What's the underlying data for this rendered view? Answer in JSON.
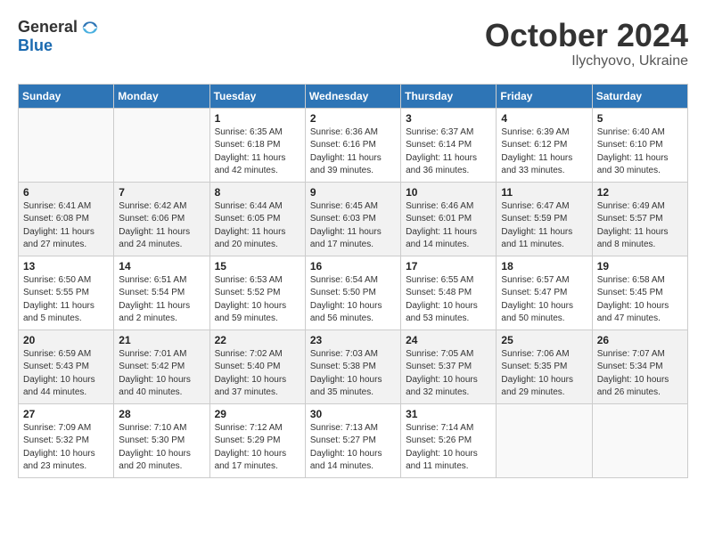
{
  "header": {
    "logo_general": "General",
    "logo_blue": "Blue",
    "month": "October 2024",
    "location": "Ilychyovo, Ukraine"
  },
  "weekdays": [
    "Sunday",
    "Monday",
    "Tuesday",
    "Wednesday",
    "Thursday",
    "Friday",
    "Saturday"
  ],
  "weeks": [
    [
      {
        "day": "",
        "info": ""
      },
      {
        "day": "",
        "info": ""
      },
      {
        "day": "1",
        "info": "Sunrise: 6:35 AM\nSunset: 6:18 PM\nDaylight: 11 hours\nand 42 minutes."
      },
      {
        "day": "2",
        "info": "Sunrise: 6:36 AM\nSunset: 6:16 PM\nDaylight: 11 hours\nand 39 minutes."
      },
      {
        "day": "3",
        "info": "Sunrise: 6:37 AM\nSunset: 6:14 PM\nDaylight: 11 hours\nand 36 minutes."
      },
      {
        "day": "4",
        "info": "Sunrise: 6:39 AM\nSunset: 6:12 PM\nDaylight: 11 hours\nand 33 minutes."
      },
      {
        "day": "5",
        "info": "Sunrise: 6:40 AM\nSunset: 6:10 PM\nDaylight: 11 hours\nand 30 minutes."
      }
    ],
    [
      {
        "day": "6",
        "info": "Sunrise: 6:41 AM\nSunset: 6:08 PM\nDaylight: 11 hours\nand 27 minutes."
      },
      {
        "day": "7",
        "info": "Sunrise: 6:42 AM\nSunset: 6:06 PM\nDaylight: 11 hours\nand 24 minutes."
      },
      {
        "day": "8",
        "info": "Sunrise: 6:44 AM\nSunset: 6:05 PM\nDaylight: 11 hours\nand 20 minutes."
      },
      {
        "day": "9",
        "info": "Sunrise: 6:45 AM\nSunset: 6:03 PM\nDaylight: 11 hours\nand 17 minutes."
      },
      {
        "day": "10",
        "info": "Sunrise: 6:46 AM\nSunset: 6:01 PM\nDaylight: 11 hours\nand 14 minutes."
      },
      {
        "day": "11",
        "info": "Sunrise: 6:47 AM\nSunset: 5:59 PM\nDaylight: 11 hours\nand 11 minutes."
      },
      {
        "day": "12",
        "info": "Sunrise: 6:49 AM\nSunset: 5:57 PM\nDaylight: 11 hours\nand 8 minutes."
      }
    ],
    [
      {
        "day": "13",
        "info": "Sunrise: 6:50 AM\nSunset: 5:55 PM\nDaylight: 11 hours\nand 5 minutes."
      },
      {
        "day": "14",
        "info": "Sunrise: 6:51 AM\nSunset: 5:54 PM\nDaylight: 11 hours\nand 2 minutes."
      },
      {
        "day": "15",
        "info": "Sunrise: 6:53 AM\nSunset: 5:52 PM\nDaylight: 10 hours\nand 59 minutes."
      },
      {
        "day": "16",
        "info": "Sunrise: 6:54 AM\nSunset: 5:50 PM\nDaylight: 10 hours\nand 56 minutes."
      },
      {
        "day": "17",
        "info": "Sunrise: 6:55 AM\nSunset: 5:48 PM\nDaylight: 10 hours\nand 53 minutes."
      },
      {
        "day": "18",
        "info": "Sunrise: 6:57 AM\nSunset: 5:47 PM\nDaylight: 10 hours\nand 50 minutes."
      },
      {
        "day": "19",
        "info": "Sunrise: 6:58 AM\nSunset: 5:45 PM\nDaylight: 10 hours\nand 47 minutes."
      }
    ],
    [
      {
        "day": "20",
        "info": "Sunrise: 6:59 AM\nSunset: 5:43 PM\nDaylight: 10 hours\nand 44 minutes."
      },
      {
        "day": "21",
        "info": "Sunrise: 7:01 AM\nSunset: 5:42 PM\nDaylight: 10 hours\nand 40 minutes."
      },
      {
        "day": "22",
        "info": "Sunrise: 7:02 AM\nSunset: 5:40 PM\nDaylight: 10 hours\nand 37 minutes."
      },
      {
        "day": "23",
        "info": "Sunrise: 7:03 AM\nSunset: 5:38 PM\nDaylight: 10 hours\nand 35 minutes."
      },
      {
        "day": "24",
        "info": "Sunrise: 7:05 AM\nSunset: 5:37 PM\nDaylight: 10 hours\nand 32 minutes."
      },
      {
        "day": "25",
        "info": "Sunrise: 7:06 AM\nSunset: 5:35 PM\nDaylight: 10 hours\nand 29 minutes."
      },
      {
        "day": "26",
        "info": "Sunrise: 7:07 AM\nSunset: 5:34 PM\nDaylight: 10 hours\nand 26 minutes."
      }
    ],
    [
      {
        "day": "27",
        "info": "Sunrise: 7:09 AM\nSunset: 5:32 PM\nDaylight: 10 hours\nand 23 minutes."
      },
      {
        "day": "28",
        "info": "Sunrise: 7:10 AM\nSunset: 5:30 PM\nDaylight: 10 hours\nand 20 minutes."
      },
      {
        "day": "29",
        "info": "Sunrise: 7:12 AM\nSunset: 5:29 PM\nDaylight: 10 hours\nand 17 minutes."
      },
      {
        "day": "30",
        "info": "Sunrise: 7:13 AM\nSunset: 5:27 PM\nDaylight: 10 hours\nand 14 minutes."
      },
      {
        "day": "31",
        "info": "Sunrise: 7:14 AM\nSunset: 5:26 PM\nDaylight: 10 hours\nand 11 minutes."
      },
      {
        "day": "",
        "info": ""
      },
      {
        "day": "",
        "info": ""
      }
    ]
  ]
}
